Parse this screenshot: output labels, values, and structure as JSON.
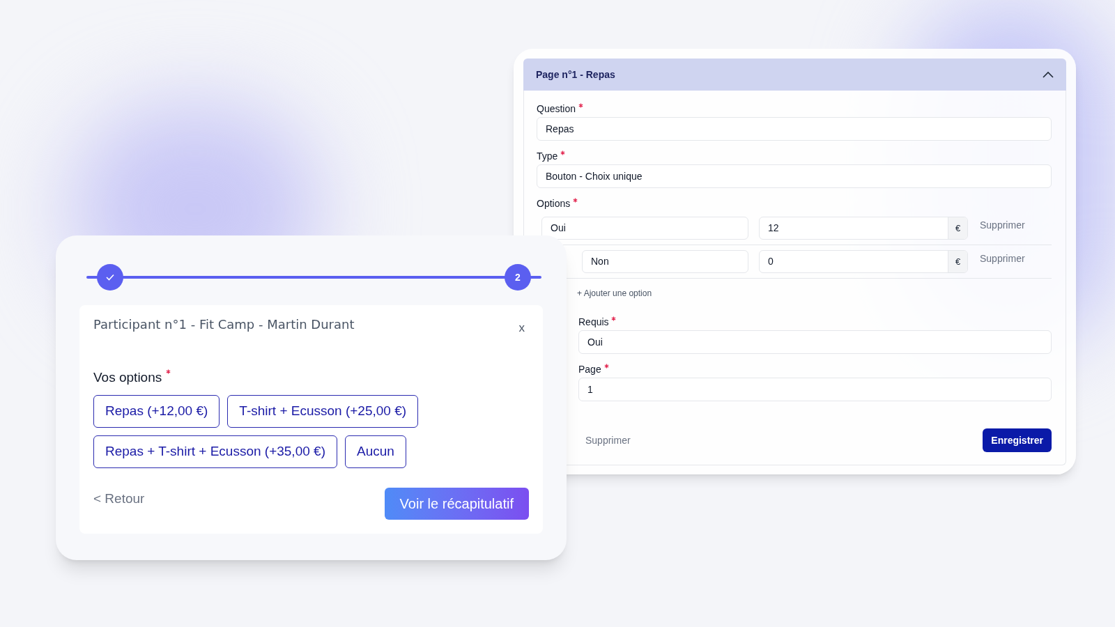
{
  "editor": {
    "header": {
      "title": "Page n°1 - Repas",
      "expanded": true
    },
    "fields": [
      {
        "kind": "text",
        "label": "Question",
        "required": true,
        "value": "Repas"
      },
      {
        "kind": "text",
        "label": "Type",
        "required": true,
        "value": "Bouton - Choix unique"
      },
      {
        "kind": "options",
        "label": "Options",
        "required": true,
        "items": [
          {
            "name": "Oui",
            "price": "12",
            "currency": "€",
            "remove": "Supprimer"
          },
          {
            "name": "Non",
            "price": "0",
            "currency": "€",
            "remove": "Supprimer"
          }
        ],
        "add": "+ Ajouter une option"
      },
      {
        "kind": "text",
        "label": "Requis",
        "required": true,
        "value": "Oui"
      },
      {
        "kind": "text",
        "label": "Page",
        "required": true,
        "value": "1"
      }
    ],
    "footer": {
      "delete": "Supprimer",
      "save": "Enregistrer"
    }
  },
  "participant": {
    "steps": [
      {
        "done": true
      },
      {
        "done": false,
        "label": "2"
      }
    ],
    "title": "Participant n°1 - Fit Camp - Martin Durant",
    "close": "x",
    "question": {
      "label": "Vos options",
      "required": true
    },
    "choices": [
      {
        "label": "Repas (+12,00 €)",
        "selected": false
      },
      {
        "label": "T-shirt + Ecusson (+25,00 €)",
        "selected": false
      },
      {
        "label": "Repas + T-shirt + Ecusson (+35,00 €)",
        "selected": false
      },
      {
        "label": "Aucun",
        "selected": false
      }
    ],
    "back": "< Retour",
    "next": "Voir le récapitulatif"
  }
}
